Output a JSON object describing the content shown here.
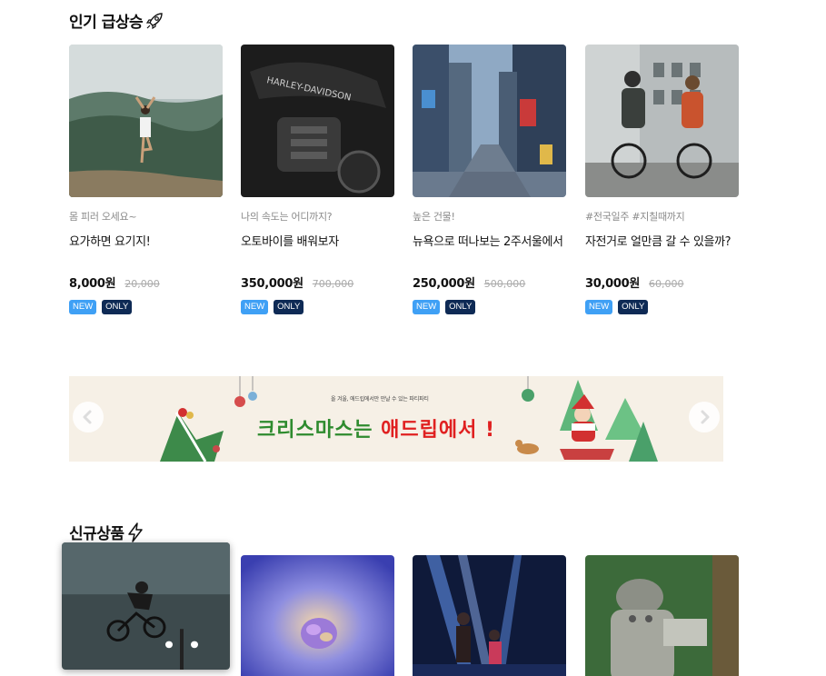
{
  "sections": {
    "hot_title": "인기 급상승",
    "new_title": "신규상품"
  },
  "hot_products": [
    {
      "subtitle": "몸 피러 오세요~",
      "name": "요가하면 요기지!",
      "price": "8,000원",
      "original_price": "20,000",
      "badges": [
        "NEW",
        "ONLY"
      ]
    },
    {
      "subtitle": "나의 속도는 어디까지?",
      "name": "오토바이를 배워보자",
      "price": "350,000원",
      "original_price": "700,000",
      "badges": [
        "NEW",
        "ONLY"
      ]
    },
    {
      "subtitle": "높은 건물!",
      "name": "뉴욕으로 떠나보는 2주서울에서",
      "price": "250,000원",
      "original_price": "500,000",
      "badges": [
        "NEW",
        "ONLY"
      ]
    },
    {
      "subtitle": "#전국일주 #지칠때까지",
      "name": "자전거로 얼만큼 갈 수 있을까?",
      "price": "30,000원",
      "original_price": "60,000",
      "badges": [
        "NEW",
        "ONLY"
      ]
    }
  ],
  "banner": {
    "subtext": "올 겨울, 애드립에서만 만날 수 있는 파티파티",
    "main_green": "크리스마스는 ",
    "main_red": "애드립에서 !"
  },
  "icons": {
    "hot_title_icon": "rocket-icon",
    "new_title_icon": "lightning-icon",
    "prev": "chevron-left-icon",
    "next": "chevron-right-icon"
  },
  "colors": {
    "badge_new": "#3fa0f5",
    "badge_only": "#0e2a55",
    "banner_bg": "#f6f0e6",
    "banner_green": "#2e8b2e",
    "banner_red": "#e02020"
  }
}
